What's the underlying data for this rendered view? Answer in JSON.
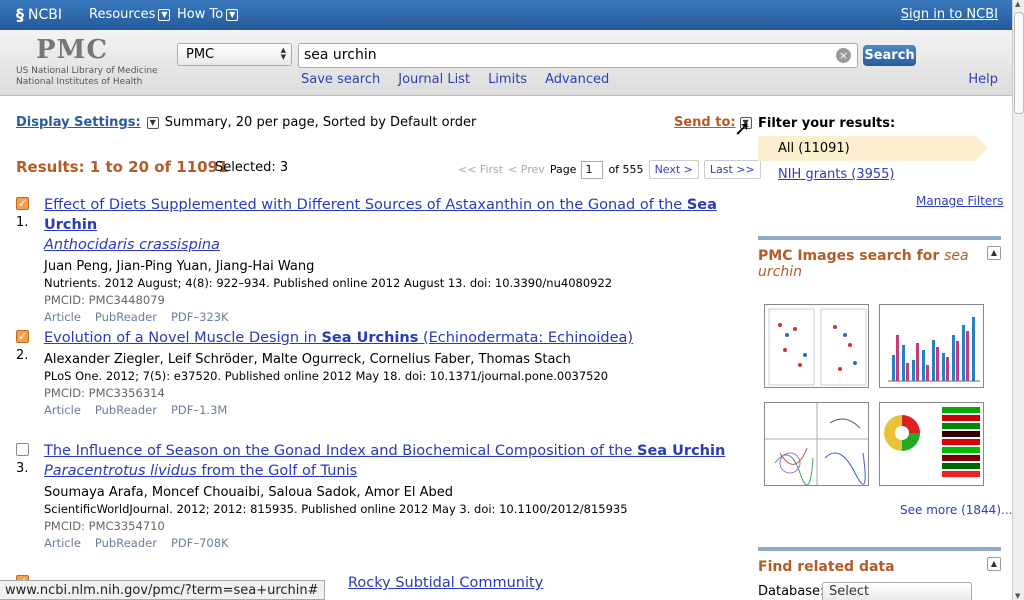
{
  "topbar": {
    "logo": "NCBI",
    "resources": "Resources",
    "howto": "How To",
    "signin": "Sign in to NCBI"
  },
  "header": {
    "logo": "PMC",
    "nlm_line1": "US National Library of Medicine",
    "nlm_line2": "National Institutes of Health",
    "db_selected": "PMC",
    "search_value": "sea urchin",
    "search_button": "Search",
    "links": [
      "Save search",
      "Journal List",
      "Limits",
      "Advanced"
    ],
    "help": "Help"
  },
  "settings": {
    "label": "Display Settings:",
    "value": "Summary, 20 per page, Sorted by Default order",
    "sendto": "Send to:"
  },
  "results": {
    "header": "Results: 1 to 20 of 11091",
    "selected": "Selected: 3",
    "pager": {
      "first": "<< First",
      "prev": "< Prev",
      "page_label": "Page",
      "page_value": "1",
      "of": "of 555",
      "next": "Next >",
      "last": "Last >>"
    },
    "items": [
      {
        "checked": true,
        "num": "1.",
        "title_pre": "Effect of Diets Supplemented with Different Sources of Astaxanthin on the Gonad of the ",
        "title_bold": "Sea Urchin",
        "title_post": "",
        "title_italic": "Anthocidaris crassispina",
        "title_end": "",
        "authors": "Juan Peng, Jian-Ping Yuan, Jiang-Hai Wang",
        "cite": "Nutrients. 2012 August; 4(8): 922–934. Published online 2012 August 13. doi: 10.3390/nu4080922",
        "pmcid": "PMCID: PMC3448079",
        "links": [
          "Article",
          "PubReader",
          "PDF–323K"
        ]
      },
      {
        "checked": true,
        "num": "2.",
        "title_pre": "Evolution of a Novel Muscle Design in ",
        "title_bold": "Sea Urchins",
        "title_post": " (Echinodermata: Echinoidea)",
        "title_italic": "",
        "title_end": "",
        "authors": "Alexander Ziegler, Leif Schröder, Malte Ogurreck, Cornelius Faber, Thomas Stach",
        "cite": "PLoS One. 2012; 7(5): e37520. Published online 2012 May 18. doi: 10.1371/journal.pone.0037520",
        "pmcid": "PMCID: PMC3356314",
        "links": [
          "Article",
          "PubReader",
          "PDF–1.3M"
        ]
      },
      {
        "checked": false,
        "num": "3.",
        "title_pre": "The Influence of Season on the Gonad Index and Biochemical Composition of the ",
        "title_bold": "Sea Urchin",
        "title_post": " ",
        "title_italic": "Paracentrotus lividus",
        "title_end": " from the Golf of Tunis",
        "authors": "Soumaya Arafa, Moncef Chouaibi, Saloua Sadok, Amor El Abed",
        "cite": "ScientificWorldJournal. 2012; 2012: 815935. Published online 2012 May 3. doi: 10.1100/2012/815935",
        "pmcid": "PMCID: PMC3354710",
        "links": [
          "Article",
          "PubReader",
          "PDF–708K"
        ]
      }
    ],
    "partial_title": "Rocky Subtidal Community"
  },
  "sidebar": {
    "filter_head": "Filter your results:",
    "filter_all": "All (11091)",
    "filter_nih": "NIH grants (3955)",
    "manage": "Manage Filters",
    "images_title": "PMC Images search for ",
    "images_query": "sea urchin",
    "see_more": "See more (1844)...",
    "related_title": "Find related data",
    "db_label": "Database:",
    "db_select": "Select"
  },
  "status": {
    "url": "www.ncbi.nlm.nih.gov/pmc/?term=sea+urchin#"
  },
  "colors": {
    "topbar": "#2b6cb0",
    "accent": "#b45b27",
    "link": "#2f3fb7"
  }
}
